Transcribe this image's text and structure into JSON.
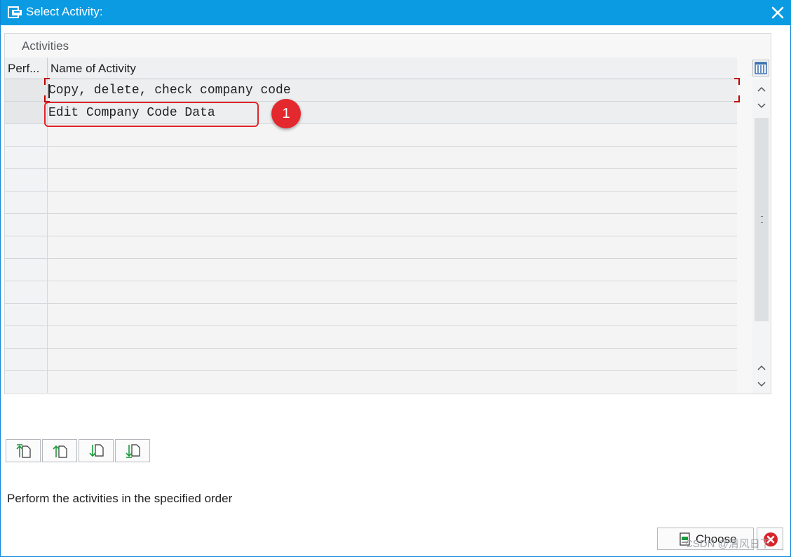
{
  "window": {
    "title": "Select Activity:"
  },
  "panel": {
    "title": "Activities"
  },
  "table": {
    "columns": [
      "Perf...",
      "Name of Activity"
    ],
    "rows": [
      {
        "name": "Copy, delete, check company code"
      },
      {
        "name": "Edit Company Code Data"
      }
    ]
  },
  "annotation": {
    "badge": "1",
    "color": "#e3282e"
  },
  "toolbar": {
    "icons": [
      "select-first-icon",
      "select-previous-icon",
      "select-next-icon",
      "select-last-icon"
    ]
  },
  "status": {
    "text": "Perform the activities in the specified order"
  },
  "buttons": {
    "choose": "Choose",
    "cancel_icon": "cancel-icon"
  },
  "watermark": "CSDN @清风日下",
  "colors": {
    "titlebar": "#0a9be3",
    "accent_green": "#1a9c3a"
  }
}
